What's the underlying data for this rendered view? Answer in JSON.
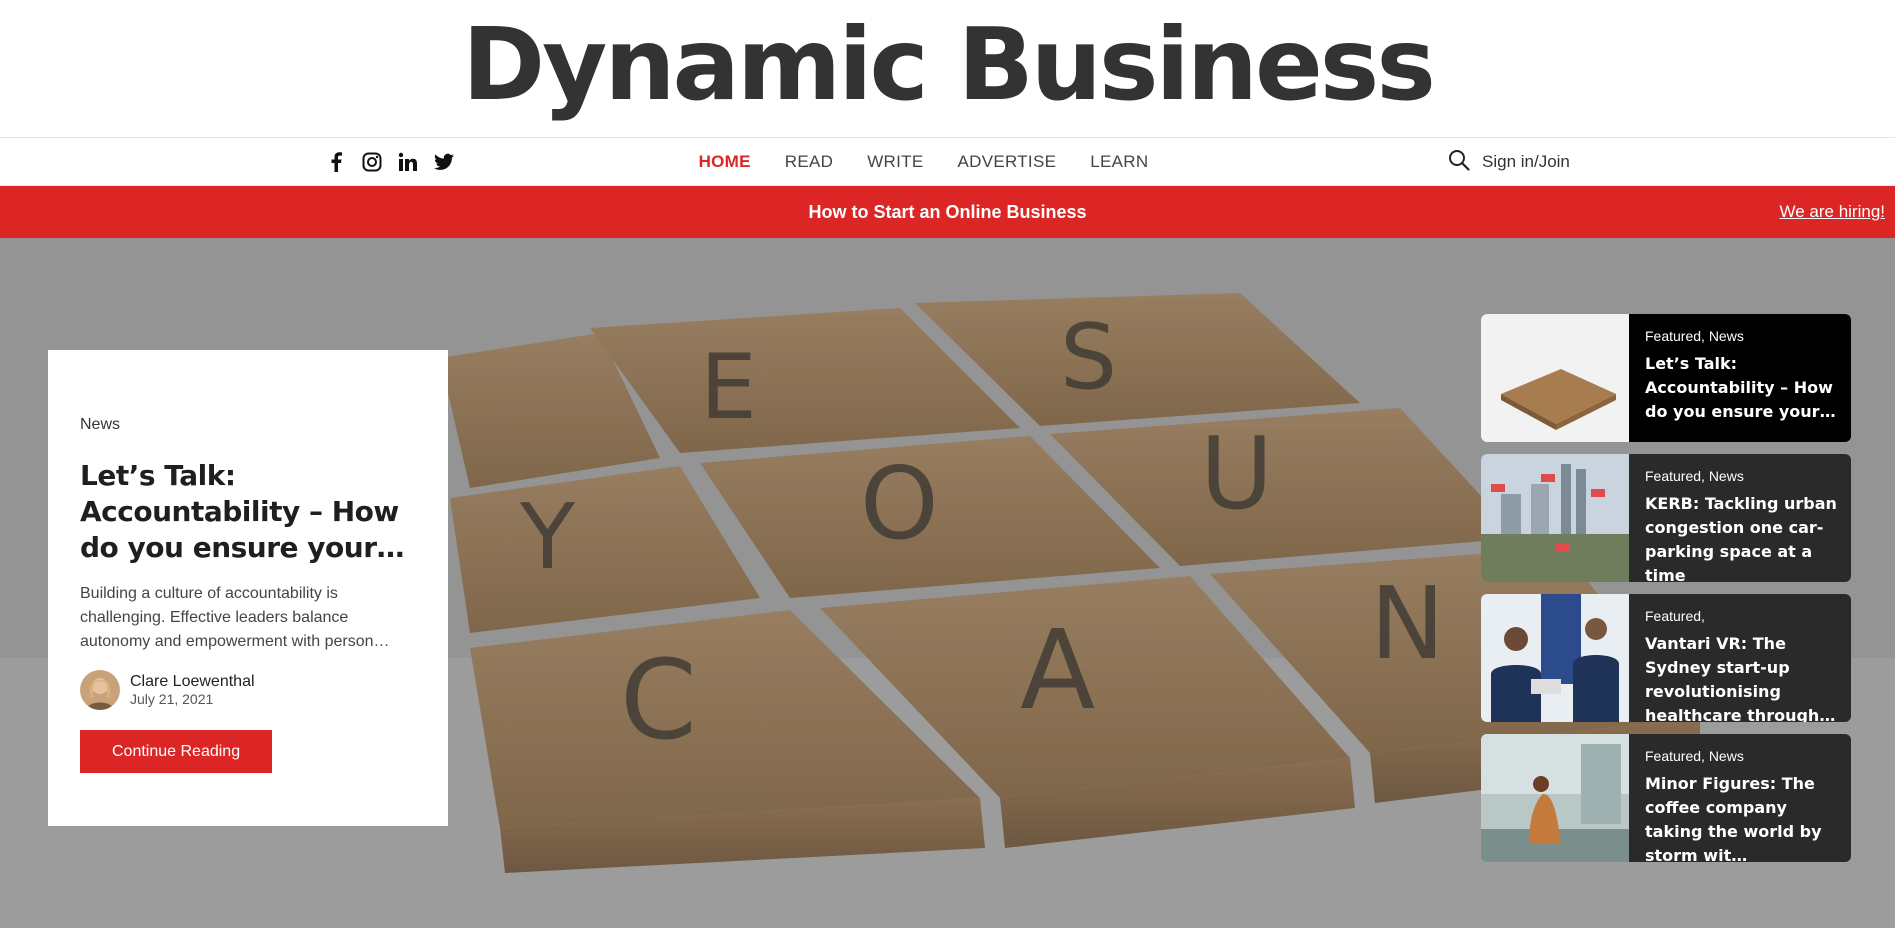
{
  "brand": {
    "logo": "Dynamic Business"
  },
  "social": {
    "icons": [
      "facebook-icon",
      "instagram-icon",
      "linkedin-icon",
      "twitter-icon"
    ]
  },
  "nav": {
    "items": [
      {
        "label": "HOME",
        "active": true
      },
      {
        "label": "READ",
        "active": false
      },
      {
        "label": "WRITE",
        "active": false
      },
      {
        "label": "ADVERTISE",
        "active": false
      },
      {
        "label": "LEARN",
        "active": false
      }
    ],
    "signin": "Sign in/Join"
  },
  "banner": {
    "promo": "How to Start an Online Business",
    "hiring": "We are hiring!"
  },
  "featured": {
    "category": "News",
    "title": "Let’s Talk: Accountability – How do you ensure your…",
    "excerpt": "Building a culture of accountability is challenging. Effective leaders balance autonomy and empowerment with person…",
    "author": "Clare Loewenthal",
    "date": "July 21, 2021",
    "cta": "Continue Reading"
  },
  "sidebar": {
    "items": [
      {
        "categories": "Featured, News",
        "title": "Let’s Talk: Accountability – How do you ensure your…"
      },
      {
        "categories": "Featured, News",
        "title": "KERB: Tackling urban congestion one car-parking space at a time"
      },
      {
        "categories": "Featured,",
        "title": "Vantari VR: The Sydney start-up revolutionising healthcare through…"
      },
      {
        "categories": "Featured, News",
        "title": "Minor Figures: The coffee company taking the world by storm wit…"
      }
    ]
  },
  "colors": {
    "accent": "#dc2626",
    "text": "#333333"
  }
}
